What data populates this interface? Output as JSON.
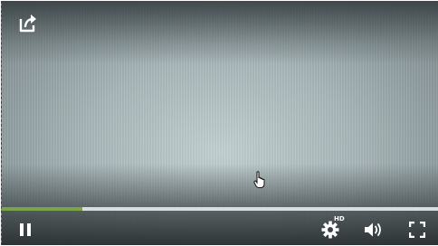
{
  "player": {
    "share": {
      "icon": "share-icon"
    },
    "progress": {
      "played_fraction": 0.185,
      "fill_color": "#7aa34b",
      "track_color": "#d8dedf"
    },
    "controls": {
      "pause": {
        "icon": "pause-icon"
      },
      "settings": {
        "icon": "gear-icon",
        "quality_badge": "HD"
      },
      "volume": {
        "icon": "volume-icon"
      },
      "fullscreen": {
        "icon": "fullscreen-icon"
      }
    },
    "cursor": {
      "icon": "hand-pointer-icon"
    }
  }
}
